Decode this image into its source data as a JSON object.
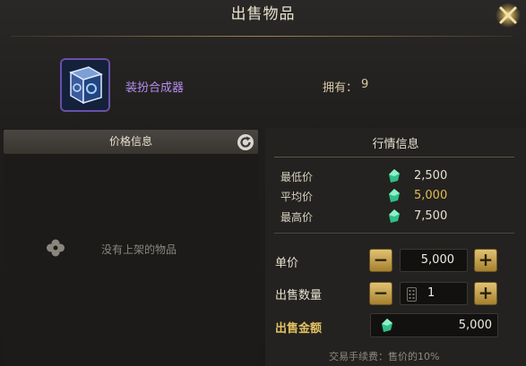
{
  "title": "出售物品",
  "item": {
    "name": "装扮合成器",
    "own_label": "拥有：",
    "own_count": "9"
  },
  "left": {
    "header": "价格信息",
    "empty_text": "没有上架的物品"
  },
  "market": {
    "header": "行情信息",
    "rows": [
      {
        "label": "最低价",
        "value": "2,500",
        "color": "#e6e0d0"
      },
      {
        "label": "平均价",
        "value": "5,000",
        "color": "#e4bd55"
      },
      {
        "label": "最高价",
        "value": "7,500",
        "color": "#e6e0d0"
      }
    ]
  },
  "form": {
    "unit_price_label": "单价",
    "unit_price": "5,000",
    "quantity_label": "出售数量",
    "quantity": "1",
    "total_label": "出售金额",
    "total": "5,000",
    "minus": "−",
    "plus": "+"
  },
  "fee_text": "交易手续费：售价的10%",
  "colors": {
    "gold": "#e3c160",
    "accent_purple": "#b78ef0",
    "gem": "#2fbf8a"
  }
}
